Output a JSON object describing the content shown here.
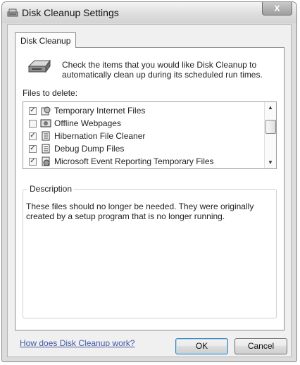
{
  "window": {
    "title": "Disk Cleanup Settings",
    "close_label": "X"
  },
  "tab": {
    "label": "Disk Cleanup"
  },
  "intro_text": "Check the items that you would like Disk Cleanup to automatically clean up during its scheduled run times.",
  "files_label": "Files to delete:",
  "files": [
    {
      "label": "Temporary Internet Files",
      "checked": true,
      "icon": "internet-files-icon"
    },
    {
      "label": "Offline Webpages",
      "checked": false,
      "icon": "offline-pages-icon"
    },
    {
      "label": "Hibernation File Cleaner",
      "checked": true,
      "icon": "document-icon"
    },
    {
      "label": "Debug Dump Files",
      "checked": true,
      "icon": "document-icon"
    },
    {
      "label": "Microsoft Event Reporting Temporary Files",
      "checked": true,
      "icon": "event-reporting-icon"
    }
  ],
  "description": {
    "legend": "Description",
    "text": "These files should no longer be needed. They were originally created by a setup program that is no longer running."
  },
  "help_link": "How does Disk Cleanup work?",
  "buttons": {
    "ok": "OK",
    "cancel": "Cancel"
  }
}
